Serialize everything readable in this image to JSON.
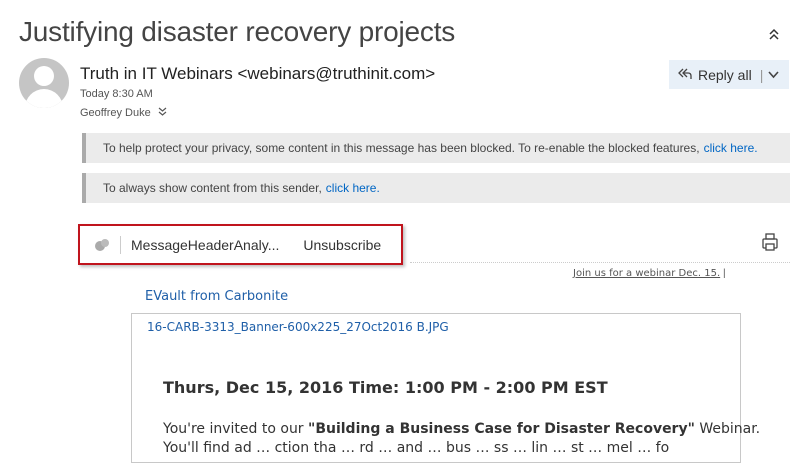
{
  "email": {
    "subject": "Justifying disaster recovery projects",
    "sender": "Truth in IT Webinars <webinars@truthinit.com>",
    "date": "Today 8:30 AM",
    "recipient": "Geoffrey Duke"
  },
  "toolbar": {
    "reply_all_label": "Reply all",
    "separator": "|"
  },
  "banners": {
    "privacy_text": "To help protect your privacy, some content in this message has been blocked. To re-enable the blocked features,",
    "privacy_link": "click here.",
    "sender_text": "To always show content from this sender,",
    "sender_link": "click here."
  },
  "addins": {
    "item1": "MessageHeaderAnaly...",
    "item2": "Unsubscribe"
  },
  "body": {
    "join_link": "Join us for a webinar Dec. 15.",
    "join_sep": "|",
    "brand": "EVault from Carbonite",
    "image_name": "16-CARB-3313_Banner-600x225_27Oct2016 B.JPG",
    "event_heading": "Thurs, Dec 15, 2016 Time: 1:00 PM - 2:00 PM EST",
    "invite_prefix": "You're invited to our ",
    "invite_bold": "\"Building a Business Case for Disaster Recovery\"",
    "invite_suffix": " Webinar.",
    "invite_line2": "You'll find ad … ction tha … rd … and … bus … ss … lin … st … mel … fo"
  },
  "colors": {
    "accent": "#0066c4",
    "highlight_border": "#c0141d",
    "reply_bg": "#e8f0f8",
    "banner_bg": "#ebebeb"
  },
  "icons": {
    "collapse": "double-chevron-up-icon",
    "reply_all": "reply-all-icon",
    "dropdown": "chevron-down-icon",
    "recipient_expand": "double-chevron-down-icon",
    "addin": "puzzle-icon",
    "print": "print-icon"
  }
}
